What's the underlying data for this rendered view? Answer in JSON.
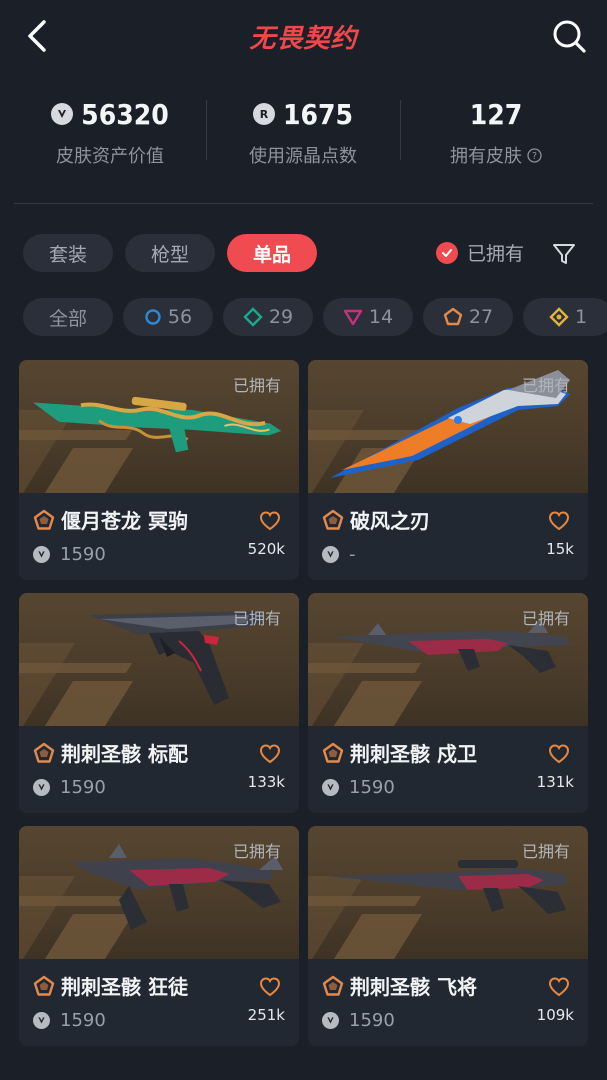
{
  "header": {
    "title": "无畏契约"
  },
  "stats": [
    {
      "value": "56320",
      "label": "皮肤资产价值",
      "icon": "vp-coin-icon"
    },
    {
      "value": "1675",
      "label": "使用源晶点数",
      "icon": "radianite-icon"
    },
    {
      "value": "127",
      "label": "拥有皮肤",
      "icon": "help-icon"
    }
  ],
  "tabs": [
    {
      "label": "套装",
      "active": false
    },
    {
      "label": "枪型",
      "active": false
    },
    {
      "label": "单品",
      "active": true
    }
  ],
  "owned_filter": {
    "label": "已拥有",
    "checked": true
  },
  "tiers": [
    {
      "label": "全部",
      "icon": ""
    },
    {
      "label": "56",
      "icon": "tier-select-icon",
      "color": "#2f87d8"
    },
    {
      "label": "29",
      "icon": "tier-deluxe-icon",
      "color": "#1aa98f"
    },
    {
      "label": "14",
      "icon": "tier-premium-icon",
      "color": "#c8307c"
    },
    {
      "label": "27",
      "icon": "tier-exclusive-icon",
      "color": "#e38a4a"
    },
    {
      "label": "1",
      "icon": "tier-ultra-icon",
      "color": "#e0b33a"
    }
  ],
  "cards": [
    {
      "owned": "已拥有",
      "name": "偃月苍龙 冥驹",
      "price": "1590",
      "likes": "520k",
      "tier_color": "#e38a4a"
    },
    {
      "owned": "已拥有",
      "name": "破风之刃",
      "price": "-",
      "likes": "15k",
      "tier_color": "#e38a4a"
    },
    {
      "owned": "已拥有",
      "name": "荆刺圣骸 标配",
      "price": "1590",
      "likes": "133k",
      "tier_color": "#e38a4a"
    },
    {
      "owned": "已拥有",
      "name": "荆刺圣骸 戍卫",
      "price": "1590",
      "likes": "131k",
      "tier_color": "#e38a4a"
    },
    {
      "owned": "已拥有",
      "name": "荆刺圣骸 狂徒",
      "price": "1590",
      "likes": "251k",
      "tier_color": "#e38a4a"
    },
    {
      "owned": "已拥有",
      "name": "荆刺圣骸 飞将",
      "price": "1590",
      "likes": "109k",
      "tier_color": "#e38a4a"
    }
  ]
}
